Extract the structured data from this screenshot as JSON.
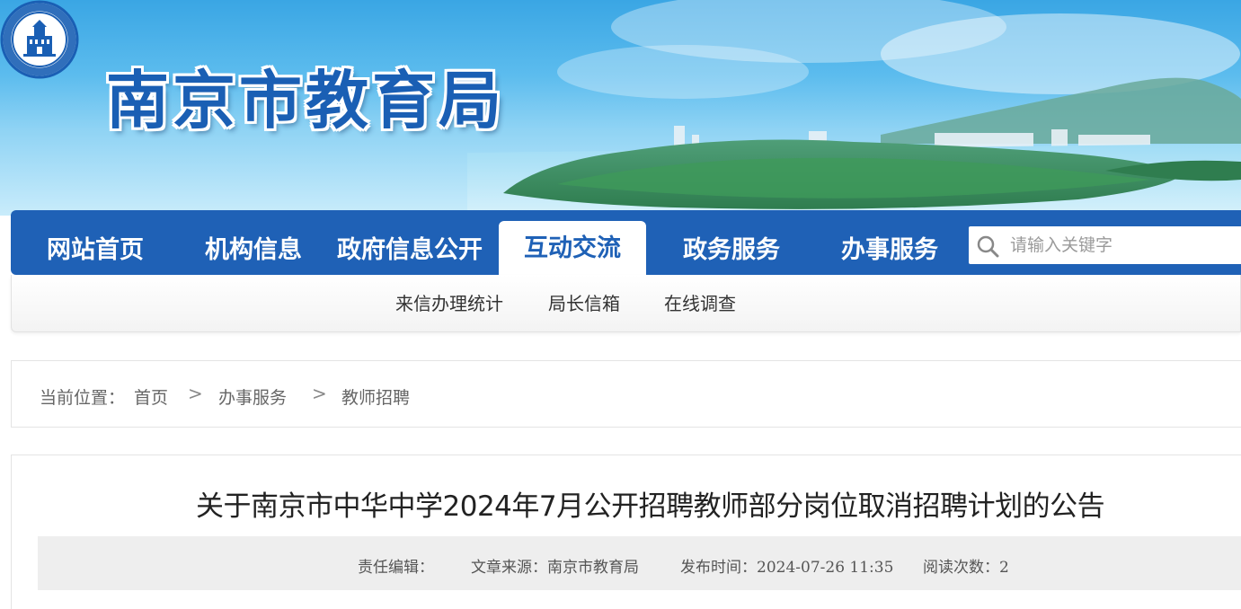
{
  "header": {
    "site_title": "南京市教育局",
    "logo_ring_text": "南京市教育局"
  },
  "nav": {
    "items": [
      {
        "label": "网站首页",
        "active": false
      },
      {
        "label": "机构信息",
        "active": false
      },
      {
        "label": "政府信息公开",
        "active": false
      },
      {
        "label": "互动交流",
        "active": true
      },
      {
        "label": "政务服务",
        "active": false
      },
      {
        "label": "办事服务",
        "active": false
      }
    ],
    "search": {
      "placeholder": "请输入关键字",
      "icon": "search-icon"
    }
  },
  "subnav": {
    "items": [
      "来信办理统计",
      "局长信箱",
      "在线调查"
    ]
  },
  "breadcrumb": {
    "prefix": "当前位置：",
    "items": [
      "首页",
      "办事服务",
      "教师招聘"
    ],
    "separator": ">"
  },
  "article": {
    "title": "关于南京市中华中学2024年7月公开招聘教师部分岗位取消招聘计划的公告",
    "meta": {
      "editor": "责任编辑：",
      "source": "文章来源：南京市教育局",
      "publish_time": "发布时间：2024-07-26 11:35",
      "read_count": "阅读次数：2"
    }
  },
  "colors": {
    "nav_blue": "#1f61b6",
    "title_blue": "#1a5fb4",
    "meta_bg": "#eeeeee"
  }
}
